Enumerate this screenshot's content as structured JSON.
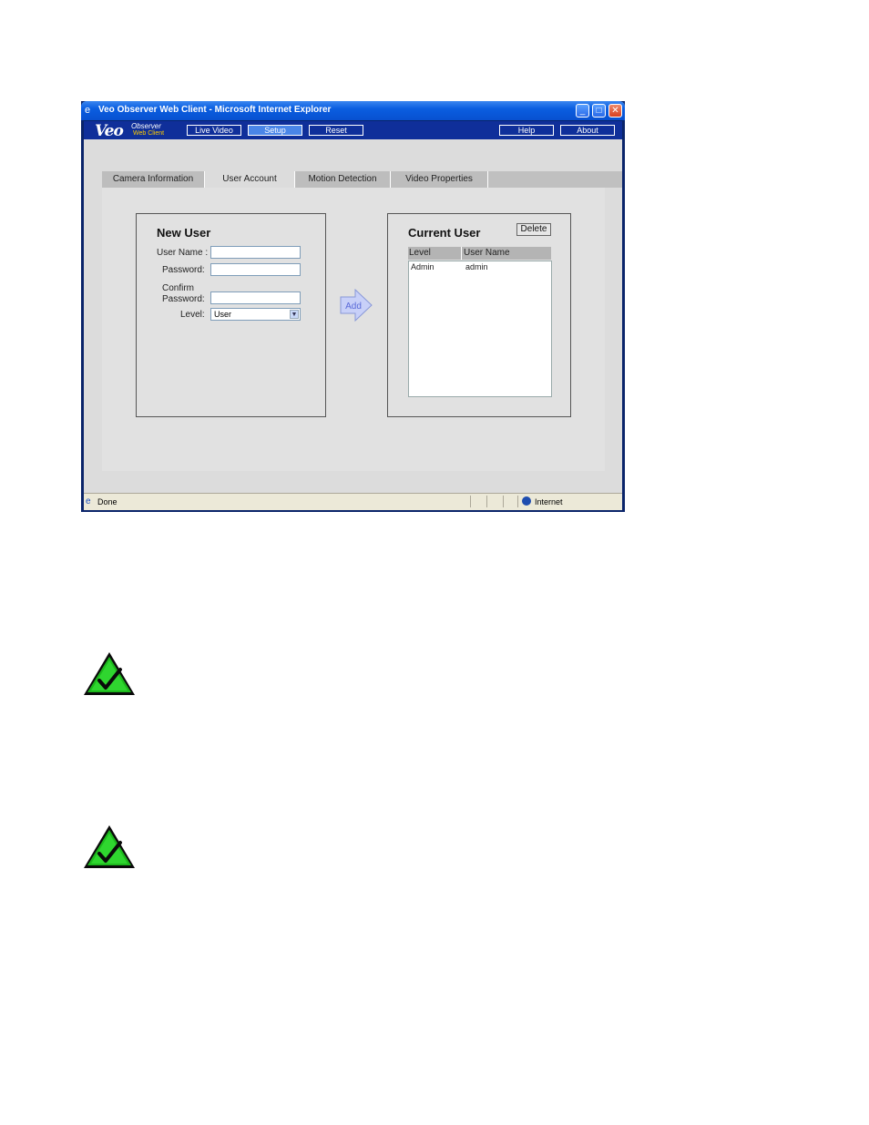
{
  "window": {
    "title": "Veo Observer Web Client - Microsoft Internet Explorer",
    "controls": {
      "minimize": "_",
      "maximize": "□",
      "close": "✕"
    }
  },
  "app": {
    "logo": "Veo",
    "logo_sub1": "Observer",
    "logo_sub2": "Web Client",
    "nav": {
      "live_video": "Live Video",
      "setup": "Setup",
      "reset": "Reset",
      "help": "Help",
      "about": "About"
    }
  },
  "tabs": {
    "camera_information": "Camera Information",
    "user_account": "User Account",
    "motion_detection": "Motion Detection",
    "video_properties": "Video Properties"
  },
  "new_user": {
    "title": "New User",
    "user_name_label": "User Name :",
    "password_label": "Password:",
    "confirm_label_1": "Confirm",
    "confirm_label_2": "Password:",
    "level_label": "Level:",
    "level_value": "User",
    "user_name_value": "",
    "password_value": "",
    "confirm_value": ""
  },
  "add_label": "Add",
  "current_user": {
    "title": "Current User",
    "delete_label": "Delete",
    "columns": {
      "level": "Level",
      "user_name": "User Name"
    },
    "rows": [
      {
        "level": "Admin",
        "user_name": "admin"
      }
    ]
  },
  "status": {
    "text": "Done",
    "zone": "Internet"
  },
  "colors": {
    "accent": "#0a246a",
    "note_green": "#1db81d"
  }
}
